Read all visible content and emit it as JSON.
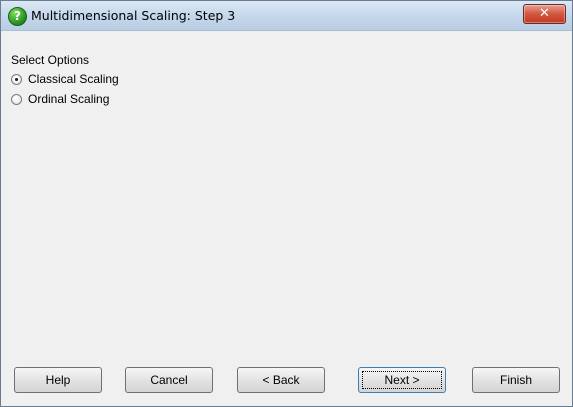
{
  "window": {
    "title": "Multidimensional Scaling: Step 3",
    "close_glyph": "✕"
  },
  "options": {
    "group_label": "Select Options",
    "items": [
      {
        "label": "Classical Scaling",
        "checked": true
      },
      {
        "label": "Ordinal Scaling",
        "checked": false
      }
    ]
  },
  "buttons": {
    "help": "Help",
    "cancel": "Cancel",
    "back": "< Back",
    "next": "Next >",
    "finish": "Finish"
  },
  "icons": {
    "title_icon": "help-question-icon",
    "close_icon": "close-icon"
  },
  "colors": {
    "title_bar": "#c4d6ea",
    "close_button": "#d2563f",
    "dialog_background": "#f0f0f0"
  }
}
